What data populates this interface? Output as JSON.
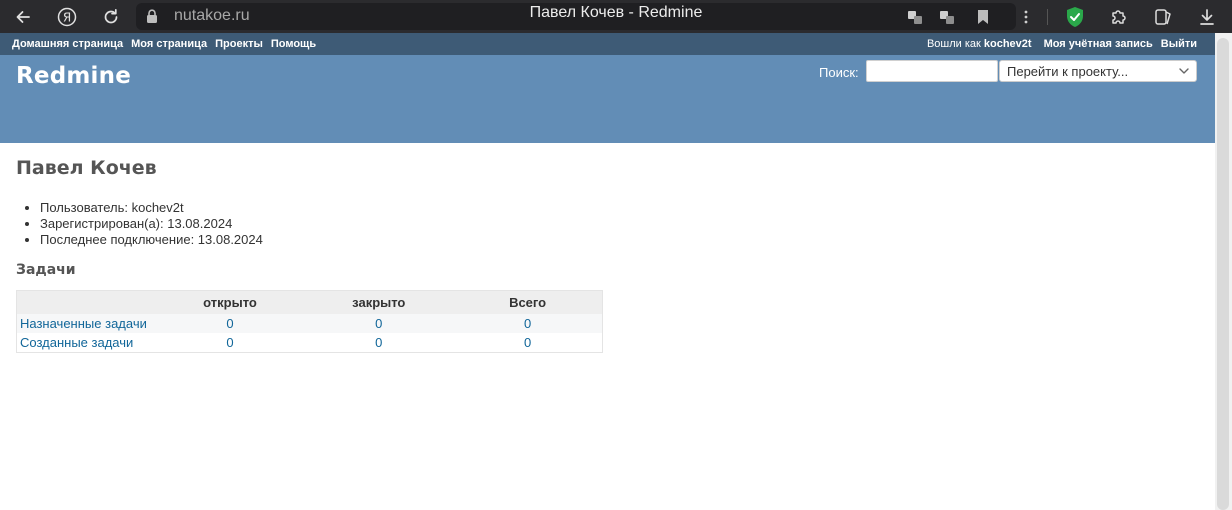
{
  "browser": {
    "url": "nutakoe.ru",
    "tab_title": "Павел Кочев - Redmine"
  },
  "top_menu": {
    "left": [
      "Домашняя страница",
      "Моя страница",
      "Проекты",
      "Помощь"
    ],
    "logged_as_label": "Вошли как",
    "logged_as_user": "kochev2t",
    "account": "Моя учётная запись",
    "logout": "Выйти"
  },
  "header": {
    "title": "Redmine",
    "search_label": "Поиск:",
    "search_value": "",
    "jump_placeholder": "Перейти к проекту..."
  },
  "user": {
    "name": "Павел Кочев",
    "info": [
      "Пользователь: kochev2t",
      "Зарегистрирован(а): 13.08.2024",
      "Последнее подключение: 13.08.2024"
    ]
  },
  "issues": {
    "heading": "Задачи",
    "columns": [
      "",
      "открыто",
      "закрыто",
      "Всего"
    ],
    "rows": [
      {
        "label": "Назначенные задачи",
        "open": "0",
        "closed": "0",
        "total": "0"
      },
      {
        "label": "Созданные задачи",
        "open": "0",
        "closed": "0",
        "total": "0"
      }
    ]
  },
  "colors": {
    "top_menu": "#3e5b76",
    "header": "#628db6",
    "link": "#116699",
    "shield": "#2aa84a"
  }
}
